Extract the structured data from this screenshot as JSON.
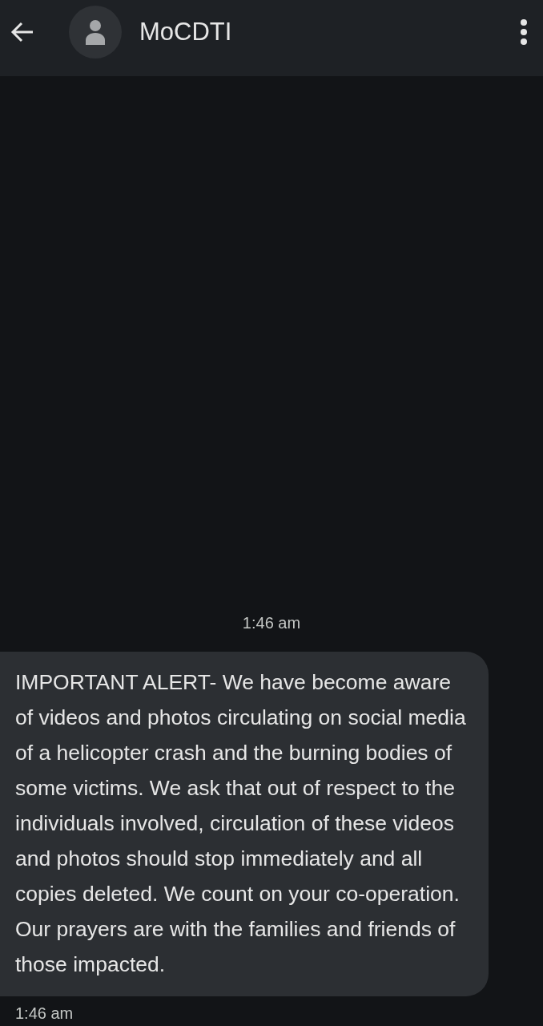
{
  "header": {
    "title": "MoCDTI"
  },
  "messages": [
    {
      "time": "1:46 am",
      "text": "IMPORTANT ALERT- We have become aware of videos and photos circulating on social media of a helicopter crash and the burning bodies of some victims. We ask that out of respect to the individuals involved, circulation of these videos and photos should stop immediately and all copies deleted. We count on your co-operation.\nOur prayers are with the families and friends of those impacted.",
      "sent_time": "1:46 am"
    }
  ]
}
